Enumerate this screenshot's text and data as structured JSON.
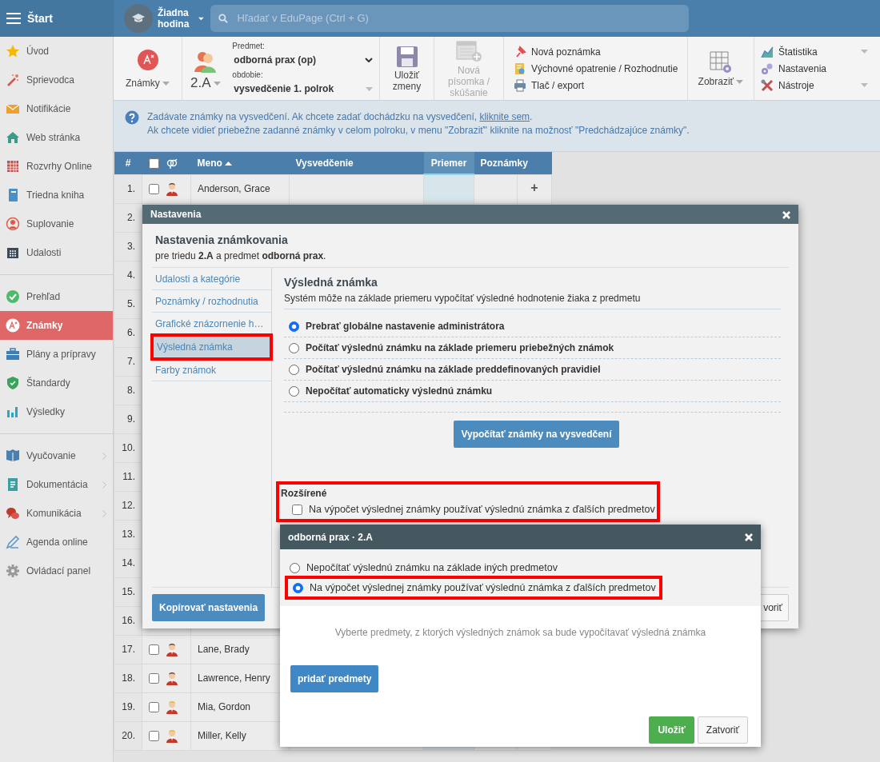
{
  "topbar": {
    "menu_label": "Štart",
    "lesson": "Žiadna hodina",
    "search": {
      "placeholder": "Hľadať v EduPage (Ctrl + G)"
    }
  },
  "sidebar": {
    "groups": [
      {
        "items": [
          {
            "label": "Úvod",
            "selected": false,
            "expandable": false
          },
          {
            "label": "Sprievodca",
            "selected": false,
            "expandable": false
          },
          {
            "label": "Notifikácie",
            "selected": false,
            "expandable": false
          },
          {
            "label": "Web stránka",
            "selected": false,
            "expandable": false
          },
          {
            "label": "Rozvrhy Online",
            "selected": false,
            "expandable": false
          },
          {
            "label": "Triedna kniha",
            "selected": false,
            "expandable": false
          },
          {
            "label": "Suplovanie",
            "selected": false,
            "expandable": false
          },
          {
            "label": "Udalosti",
            "selected": false,
            "expandable": false
          }
        ]
      },
      {
        "items": [
          {
            "label": "Prehľad",
            "selected": false,
            "expandable": false
          },
          {
            "label": "Známky",
            "selected": true,
            "expandable": false
          },
          {
            "label": "Plány a prípravy",
            "selected": false,
            "expandable": false
          },
          {
            "label": "Štandardy",
            "selected": false,
            "expandable": false
          },
          {
            "label": "Výsledky",
            "selected": false,
            "expandable": false
          }
        ]
      },
      {
        "items": [
          {
            "label": "Vyučovanie",
            "selected": false,
            "expandable": true
          },
          {
            "label": "Dokumentácia",
            "selected": false,
            "expandable": true
          },
          {
            "label": "Komunikácia",
            "selected": false,
            "expandable": true
          },
          {
            "label": "Agenda online",
            "selected": false,
            "expandable": false
          },
          {
            "label": "Ovládací panel",
            "selected": false,
            "expandable": false
          }
        ]
      }
    ]
  },
  "toolbar": {
    "grades": {
      "label": "Známky",
      "has_menu": true
    },
    "class": {
      "label": "2.A",
      "has_menu": true
    },
    "subject": {
      "label": "Predmet:",
      "value": "odborná prax (op)"
    },
    "period": {
      "label": "obdobie:",
      "value": "vysvedčenie 1. polrok"
    },
    "save": {
      "label": "Uložiť zmeny",
      "disabled": false
    },
    "new_test": {
      "label": "Nová písomka / skúšanie",
      "disabled": true
    },
    "actions": [
      {
        "label": "Nová poznámka"
      },
      {
        "label": "Výchovné opatrenie / Rozhodnutie"
      },
      {
        "label": "Tlač / export"
      }
    ],
    "view": {
      "label": "Zobraziť",
      "has_menu": true
    },
    "tools": [
      {
        "label": "Štatistika",
        "has_menu": true
      },
      {
        "label": "Nastavenia",
        "has_menu": false
      },
      {
        "label": "Nástroje",
        "has_menu": true
      }
    ]
  },
  "info": {
    "text": "Zadávate známky na vysvedčení. Ak chcete zadať dochádzku na vysvedčení,",
    "link": "kliknite sem",
    "text_end": ".",
    "line2": "Ak chcete vidieť priebežne zadanné známky v celom polroku, v menu \"Zobraziť\" kliknite na možnosť \"Predchádzajúce známky\"."
  },
  "table": {
    "columns": [
      {
        "label": "#",
        "selected": false
      },
      {
        "kind": "select",
        "checked": false,
        "selected": false
      },
      {
        "label": "Meno",
        "sorted": true,
        "selected": false
      },
      {
        "label": "Vysvedčenie",
        "selected": false
      },
      {
        "label": "Priemer",
        "selected": true
      },
      {
        "label": "Poznámky",
        "selected": false
      }
    ],
    "rows": [
      {
        "number": "1.",
        "checked": false,
        "name": "Anderson, Grace",
        "avatar": {
          "kind": "dark"
        },
        "add": "+"
      },
      {
        "number": "2."
      },
      {
        "number": "3."
      },
      {
        "number": "4."
      },
      {
        "number": "5."
      },
      {
        "number": "6."
      },
      {
        "number": "7."
      },
      {
        "number": "8."
      },
      {
        "number": "9."
      },
      {
        "number": "10."
      },
      {
        "number": "11."
      },
      {
        "number": "12."
      },
      {
        "number": "13."
      },
      {
        "number": "14."
      },
      {
        "number": "15."
      },
      {
        "number": "16."
      },
      {
        "number": "17.",
        "checked": false,
        "name": "Lane, Brady",
        "avatar": {
          "kind": "dark"
        }
      },
      {
        "number": "18.",
        "checked": false,
        "name": "Lawrence, Henry",
        "avatar": {
          "kind": "dark"
        }
      },
      {
        "number": "19.",
        "checked": false,
        "name": "Mia, Gordon",
        "avatar": {
          "kind": "blond"
        }
      },
      {
        "number": "20.",
        "checked": false,
        "name": "Miller, Kelly",
        "avatar": {
          "kind": "blond"
        }
      }
    ]
  },
  "settings_dialog": {
    "title": "Nastavenia",
    "heading": "Nastavenia známkovania",
    "subtitle": "pre triedu **2.A** a predmet **odborná prax**.",
    "nav": [
      {
        "label": "Udalosti a kategórie",
        "selected": false,
        "highlighted": false
      },
      {
        "label": "Poznámky / rozhodnutia",
        "selected": false,
        "highlighted": false
      },
      {
        "label": "Grafické znázornenie h…",
        "selected": false,
        "highlighted": false
      },
      {
        "label": "Výsledná známka",
        "selected": true,
        "highlighted": true
      },
      {
        "label": "Farby známok",
        "selected": false,
        "highlighted": false
      }
    ],
    "section": {
      "title": "Výsledná známka",
      "description": "Systém môže na základe priemeru vypočítať výsledné hodnotenie žiaka z predmetu",
      "options": [
        {
          "label": "Prebrať globálne nastavenie administrátora",
          "selected": true
        },
        {
          "label": "Počítať výslednú známku na základe priemeru priebežných známok",
          "selected": false
        },
        {
          "label": "Počítať výslednú známku na základe preddefinovaných pravidiel",
          "selected": false
        },
        {
          "label": "Nepočítať automaticky výslednú známku",
          "selected": false
        }
      ],
      "calculate_button": "Vypočítať známky na vysvedčení"
    },
    "advanced": {
      "title": "Rozšírené",
      "highlighted": true,
      "checkbox": {
        "label": "Na výpočet výslednej známky používať výslednú známka z ďalších predmetov",
        "checked": false
      }
    },
    "copy_button": "Kopírovať nastavenia",
    "close_button": "voriť"
  },
  "subject_dialog": {
    "title": "odborná prax · 2.A",
    "options": [
      {
        "label": "Nepočítať výslednú známku na základe iných predmetov",
        "selected": false,
        "highlighted": false
      },
      {
        "label": "Na výpočet výslednej známky používať výslednú známka z ďalších predmetov",
        "selected": true,
        "highlighted": true
      }
    ],
    "hint": "Vyberte predmety, z ktorých výsledných známok sa bude vypočítavať výsledná známka",
    "add_button": "pridať predmety",
    "save_button": "Uložiť",
    "close_button": "Zatvoriť"
  }
}
